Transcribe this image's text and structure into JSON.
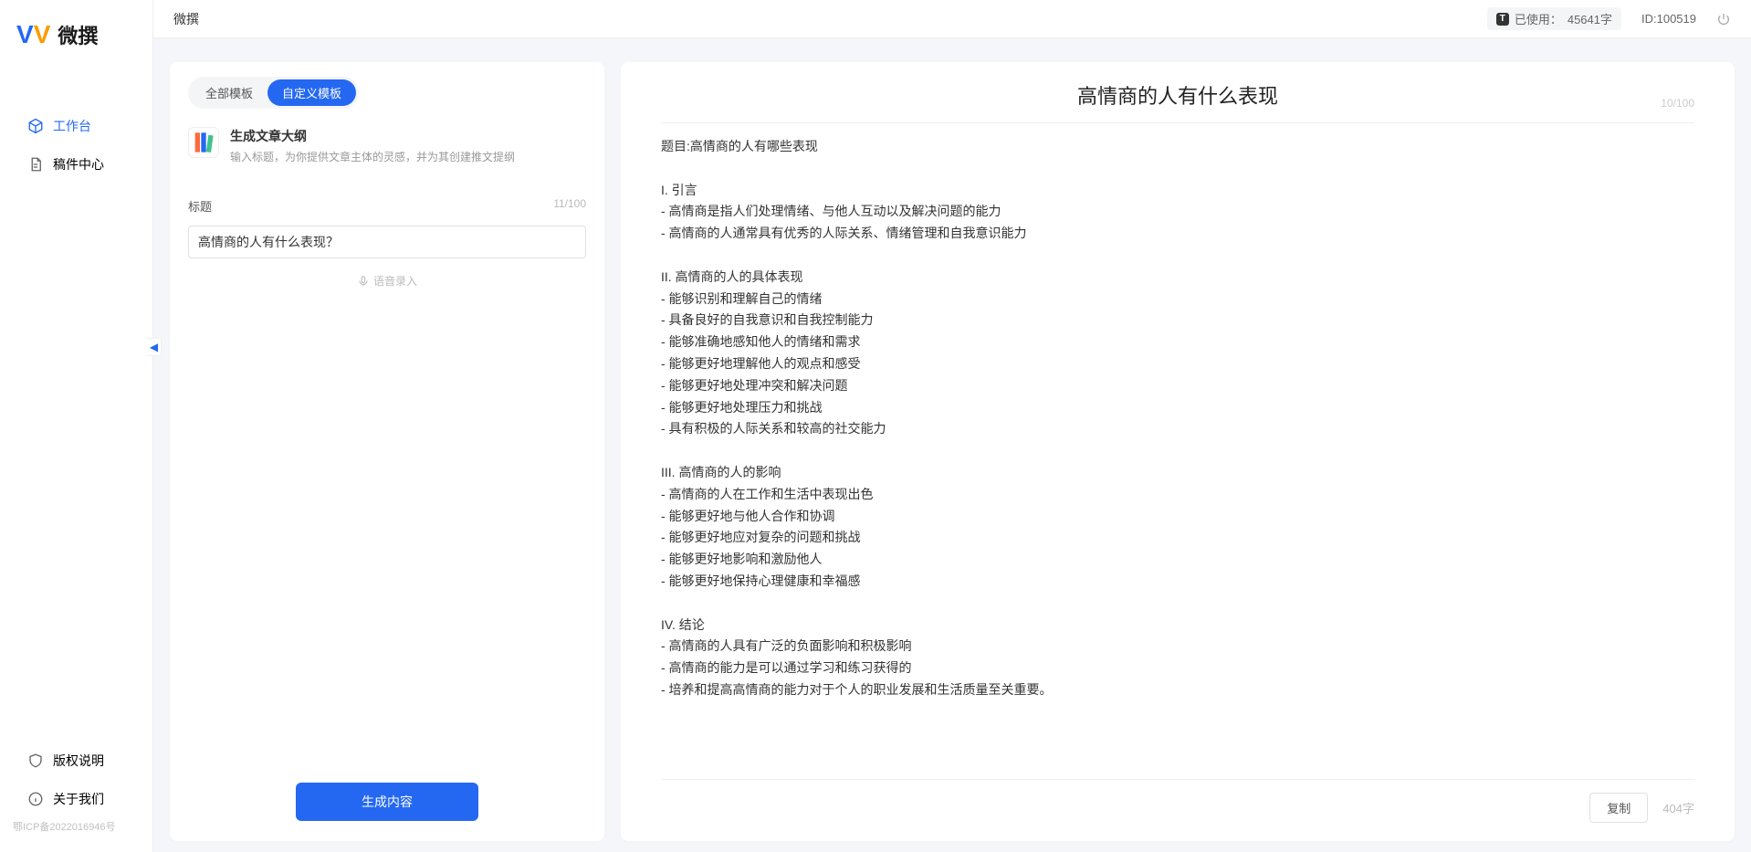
{
  "app": {
    "name": "微撰"
  },
  "sidebar": {
    "nav": [
      {
        "label": "工作台",
        "icon": "cube",
        "active": true
      },
      {
        "label": "稿件中心",
        "icon": "document",
        "active": false
      }
    ],
    "footer": [
      {
        "label": "版权说明",
        "icon": "shield"
      },
      {
        "label": "关于我们",
        "icon": "info"
      }
    ],
    "icp": "鄂ICP备2022016946号"
  },
  "topbar": {
    "title": "微撰",
    "usage_prefix": "已使用：",
    "usage_value": "45641字",
    "id_label": "ID:100519"
  },
  "left": {
    "tabs": [
      "全部模板",
      "自定义模板"
    ],
    "active_tab": 1,
    "template": {
      "title": "生成文章大纲",
      "desc": "输入标题，为你提供文章主体的灵感，并为其创建推文提纲"
    },
    "field_label": "标题",
    "field_count": "11/100",
    "input_value": "高情商的人有什么表现？",
    "voice_label": "语音录入",
    "generate_label": "生成内容"
  },
  "right": {
    "title": "高情商的人有什么表现",
    "title_count": "10/100",
    "body": "题目:高情商的人有哪些表现\n\nI. 引言\n- 高情商是指人们处理情绪、与他人互动以及解决问题的能力\n- 高情商的人通常具有优秀的人际关系、情绪管理和自我意识能力\n\nII. 高情商的人的具体表现\n- 能够识别和理解自己的情绪\n- 具备良好的自我意识和自我控制能力\n- 能够准确地感知他人的情绪和需求\n- 能够更好地理解他人的观点和感受\n- 能够更好地处理冲突和解决问题\n- 能够更好地处理压力和挑战\n- 具有积极的人际关系和较高的社交能力\n\nIII. 高情商的人的影响\n- 高情商的人在工作和生活中表现出色\n- 能够更好地与他人合作和协调\n- 能够更好地应对复杂的问题和挑战\n- 能够更好地影响和激励他人\n- 能够更好地保持心理健康和幸福感\n\nIV. 结论\n- 高情商的人具有广泛的负面影响和积极影响\n- 高情商的能力是可以通过学习和练习获得的\n- 培养和提高高情商的能力对于个人的职业发展和生活质量至关重要。",
    "copy_label": "复制",
    "char_count": "404字"
  }
}
